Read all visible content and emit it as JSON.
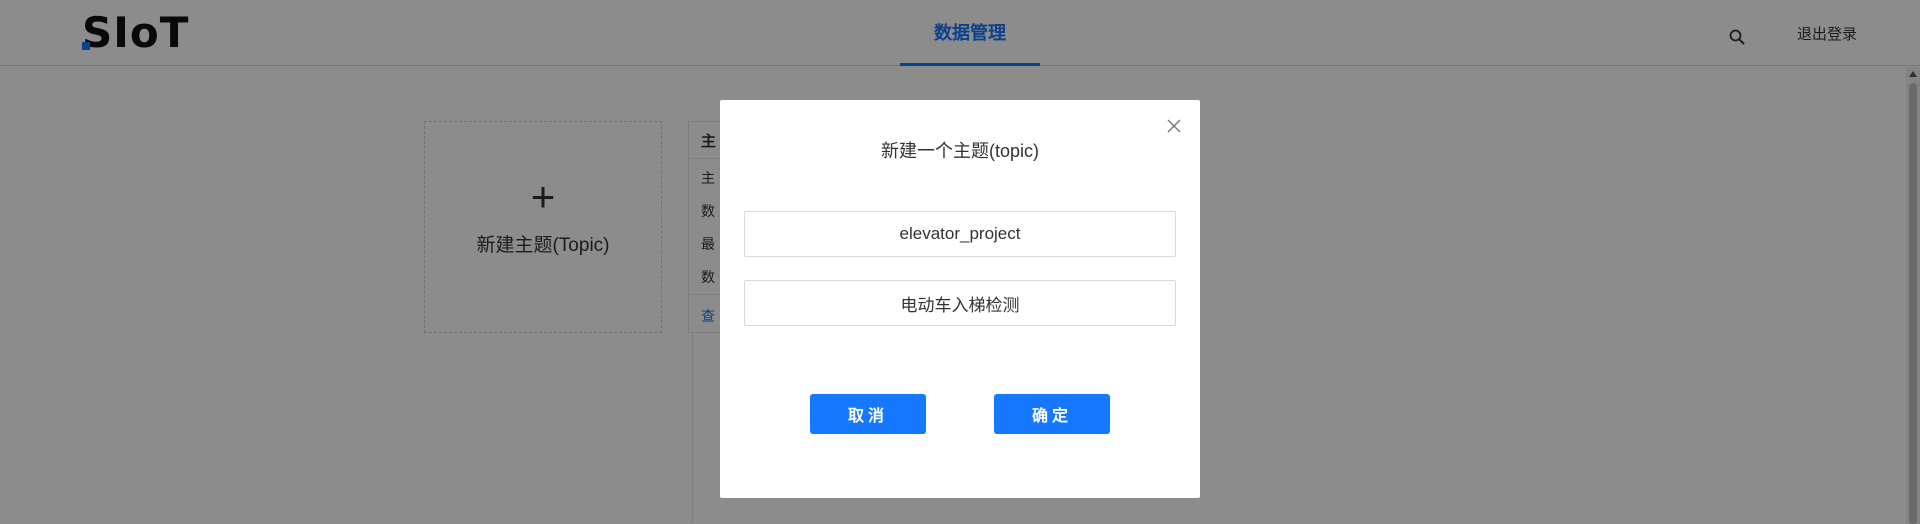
{
  "header": {
    "logo_text": "SIoT",
    "nav_tab": "数据管理",
    "search_icon": "search-icon",
    "logout_label": "退出登录",
    "accent_color": "#1677ff"
  },
  "main": {
    "new_topic_card": {
      "plus_icon": "plus-icon",
      "label": "新建主题(Topic)"
    },
    "topic_card": {
      "header": "主",
      "rows": [
        "主",
        "数",
        "最",
        "数"
      ],
      "link": "查"
    }
  },
  "modal": {
    "title": "新建一个主题(topic)",
    "close_icon": "close-icon",
    "topic_value": "elevator_project",
    "description_value": "电动车入梯检测",
    "cancel_label": "取消",
    "ok_label": "确定"
  }
}
